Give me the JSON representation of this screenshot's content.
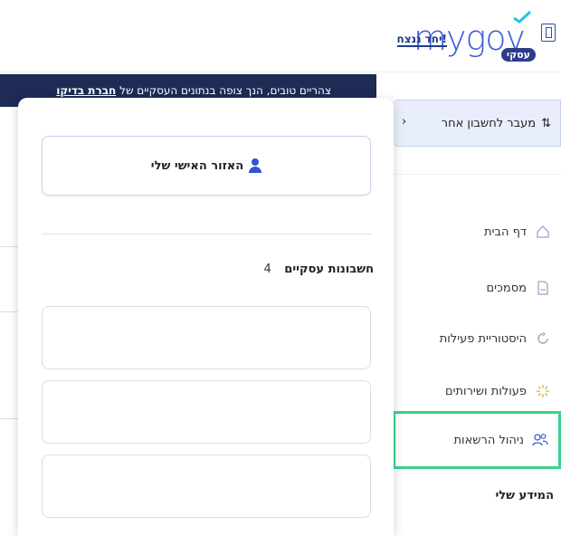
{
  "header": {
    "logo_text": "mygov",
    "logo_badge": "עסקי",
    "together_text": "יחד ננצח!"
  },
  "banner": {
    "text": "צהריים טובים, הנך צופה בנתונים העסקיים של",
    "company": "חברת בדיקו"
  },
  "sidebar": {
    "switch_account_label": "מעבר לחשבון אחר",
    "items": [
      {
        "label": "דף הבית",
        "icon": "home-icon"
      },
      {
        "label": "מסמכים",
        "icon": "document-icon"
      },
      {
        "label": "היסטוריית פעילות",
        "icon": "history-icon"
      },
      {
        "label": "פעולות ושירותים",
        "icon": "services-icon"
      },
      {
        "label": "ניהול הרשאות",
        "icon": "users-icon"
      }
    ],
    "my_info_label": "המידע שלי"
  },
  "panel": {
    "personal_area_label": "האזור האישי שלי",
    "accounts_title": "חשבונות עסקיים",
    "accounts_count": "4"
  },
  "colors": {
    "brand_blue": "#3b5bd6",
    "banner_navy": "#1d2b55",
    "active_green": "#3ad28a",
    "switch_bg": "#e9eefc"
  }
}
